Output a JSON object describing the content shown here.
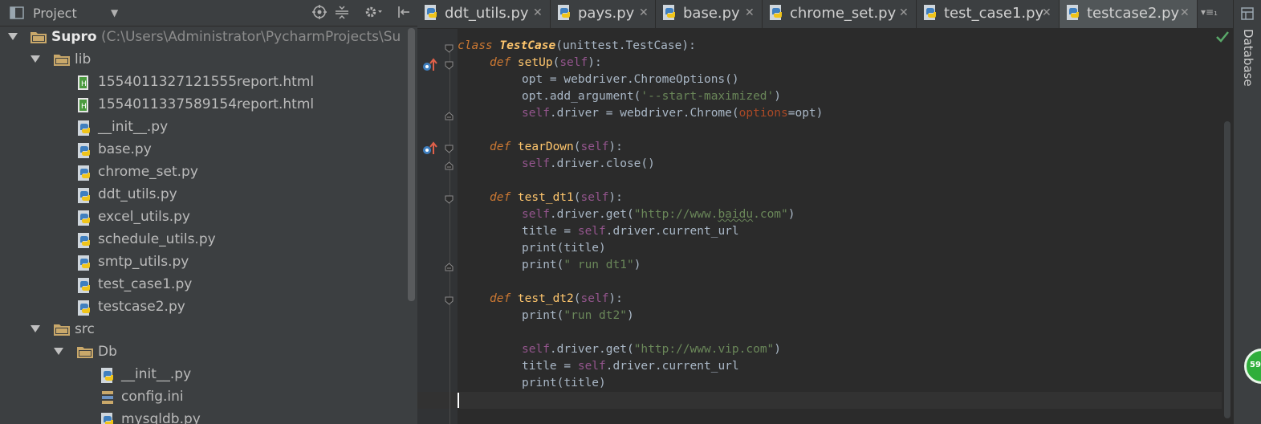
{
  "project_panel": {
    "title": "Project"
  },
  "tree": [
    {
      "label": "Supro",
      "path": " (C:\\Users\\Administrator\\PycharmProjects\\Su",
      "type": "folder",
      "depth": 0
    },
    {
      "label": "lib",
      "type": "folder",
      "depth": 1
    },
    {
      "label": "1554011327121555report.html",
      "type": "html",
      "depth": 2
    },
    {
      "label": "1554011337589154report.html",
      "type": "html",
      "depth": 2
    },
    {
      "label": "__init__.py",
      "type": "py",
      "depth": 2
    },
    {
      "label": "base.py",
      "type": "py",
      "depth": 2
    },
    {
      "label": "chrome_set.py",
      "type": "py",
      "depth": 2
    },
    {
      "label": "ddt_utils.py",
      "type": "py",
      "depth": 2
    },
    {
      "label": "excel_utils.py",
      "type": "py",
      "depth": 2
    },
    {
      "label": "schedule_utils.py",
      "type": "py",
      "depth": 2
    },
    {
      "label": "smtp_utils.py",
      "type": "py",
      "depth": 2
    },
    {
      "label": "test_case1.py",
      "type": "py",
      "depth": 2
    },
    {
      "label": "testcase2.py",
      "type": "py",
      "depth": 2
    },
    {
      "label": "src",
      "type": "folder",
      "depth": 1
    },
    {
      "label": "Db",
      "type": "folder",
      "depth": 2
    },
    {
      "label": "__init__.py",
      "type": "py",
      "depth": 3
    },
    {
      "label": "config.ini",
      "type": "ini",
      "depth": 3
    },
    {
      "label": "mysqldb.py",
      "type": "py",
      "depth": 3
    }
  ],
  "tabs": [
    {
      "label": "ddt_utils.py",
      "active": false
    },
    {
      "label": "pays.py",
      "active": false
    },
    {
      "label": "base.py",
      "active": false
    },
    {
      "label": "chrome_set.py",
      "active": false
    },
    {
      "label": "test_case1.py",
      "active": false
    },
    {
      "label": "testcase2.py",
      "active": true
    }
  ],
  "tab_overflow": "▾≡₁",
  "code": {
    "l1": {
      "kw": "class ",
      "name": "TestCase",
      "rest": "(unittest.TestCase):"
    },
    "l2": {
      "kw": "def ",
      "fn": "setUp",
      "p1": "(",
      "slf": "self",
      "p2": "):"
    },
    "l3": {
      "text": "opt = webdriver.ChromeOptions()"
    },
    "l4": {
      "a": "opt.add_argument(",
      "str": "'--start-maximized'",
      "b": ")"
    },
    "l5": {
      "slf": "self",
      "a": ".driver = webdriver.Chrome(",
      "param": "options",
      "b": "=opt)"
    },
    "l7": {
      "kw": "def ",
      "fn": "tearDown",
      "p1": "(",
      "slf": "self",
      "p2": "):"
    },
    "l8": {
      "slf": "self",
      "a": ".driver.close()"
    },
    "l10": {
      "kw": "def ",
      "fn": "test_dt1",
      "p1": "(",
      "slf": "self",
      "p2": "):"
    },
    "l11": {
      "slf": "self",
      "a": ".driver.get(",
      "str1": "\"http://www.",
      "str2": "baidu",
      "str3": ".com\"",
      "b": ")"
    },
    "l12": {
      "a": "title = ",
      "slf": "self",
      "b": ".driver.current_url"
    },
    "l13": {
      "text": "print(title)"
    },
    "l14": {
      "a": "print(",
      "str": "\" run dt1\"",
      "b": ")"
    },
    "l16": {
      "kw": "def ",
      "fn": "test_dt2",
      "p1": "(",
      "slf": "self",
      "p2": "):"
    },
    "l17": {
      "a": "print(",
      "str": "\"run dt2\"",
      "b": ")"
    },
    "l19": {
      "slf": "self",
      "a": ".driver.get(",
      "str": "\"http://www.vip.com\"",
      "b": ")"
    },
    "l20": {
      "a": "title = ",
      "slf": "self",
      "b": ".driver.current_url"
    },
    "l21": {
      "text": "print(title)"
    }
  },
  "right_bar": {
    "label": "Database"
  },
  "bubble": {
    "text": "59"
  }
}
